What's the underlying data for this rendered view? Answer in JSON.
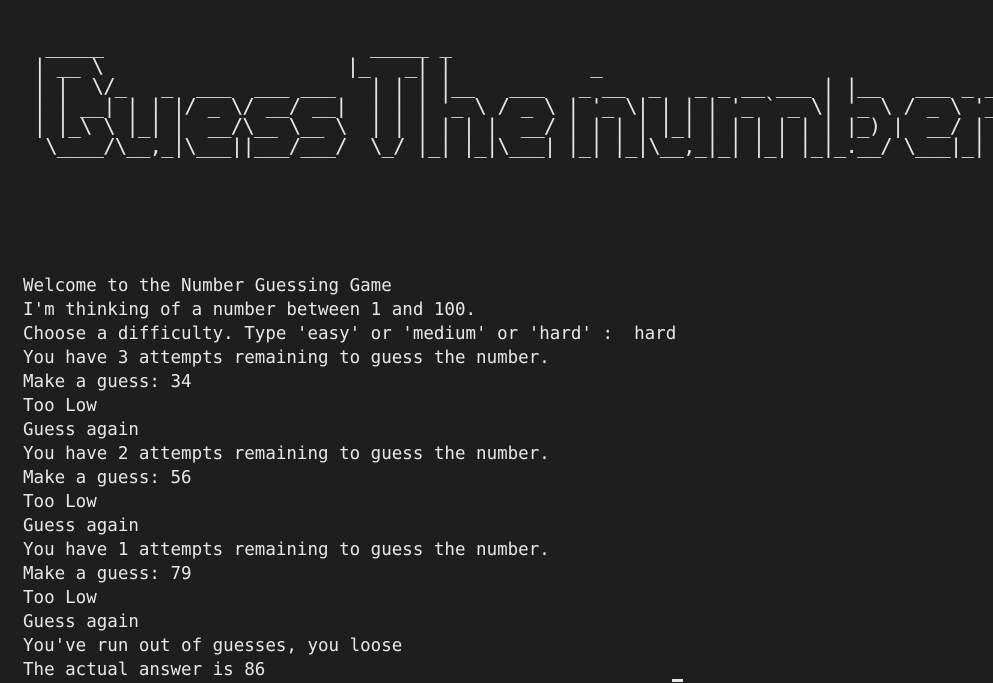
{
  "banner": {
    "art": "  _____                       _____ _               \n | __ \\                     |_   _| |            _ \n | |  \\/_   _  ___  ___ ___   | | | |__   ___   _ __  _   _ _ __ ___ | |__   ___ _ __ \n | | __| | | |/ _ \\/ __/ __|  | | | '_ \\ / _ \\ | '_ \\| | | | '_ ` _ \\| '_ \\ / _ \\ '__|\n | |_\\ \\ |_| |  __/\\__ \\__ \\  | | | | | |  __/ | | | | |_| | | | | | | |_) |  __/ |\n  \\____/\\__,_|\\___||___/___/  \\_/ |_| |_|\\___| |_| |_|\\__,_|_| |_| |_|_.__/ \\___|_|",
    "label": "Guess The number"
  },
  "output_lines": [
    "Welcome to the Number Guessing Game",
    "I'm thinking of a number between 1 and 100.",
    "Choose a difficulty. Type 'easy' or 'medium' or 'hard' :  hard",
    "You have 3 attempts remaining to guess the number.",
    "Make a guess: 34",
    "Too Low",
    "Guess again",
    "You have 2 attempts remaining to guess the number.",
    "Make a guess: 56",
    "Too Low",
    "Guess again",
    "You have 1 attempts remaining to guess the number.",
    "Make a guess: 79",
    "Too Low",
    "Guess again",
    "You've run out of guesses, you loose",
    "The actual answer is 86"
  ]
}
